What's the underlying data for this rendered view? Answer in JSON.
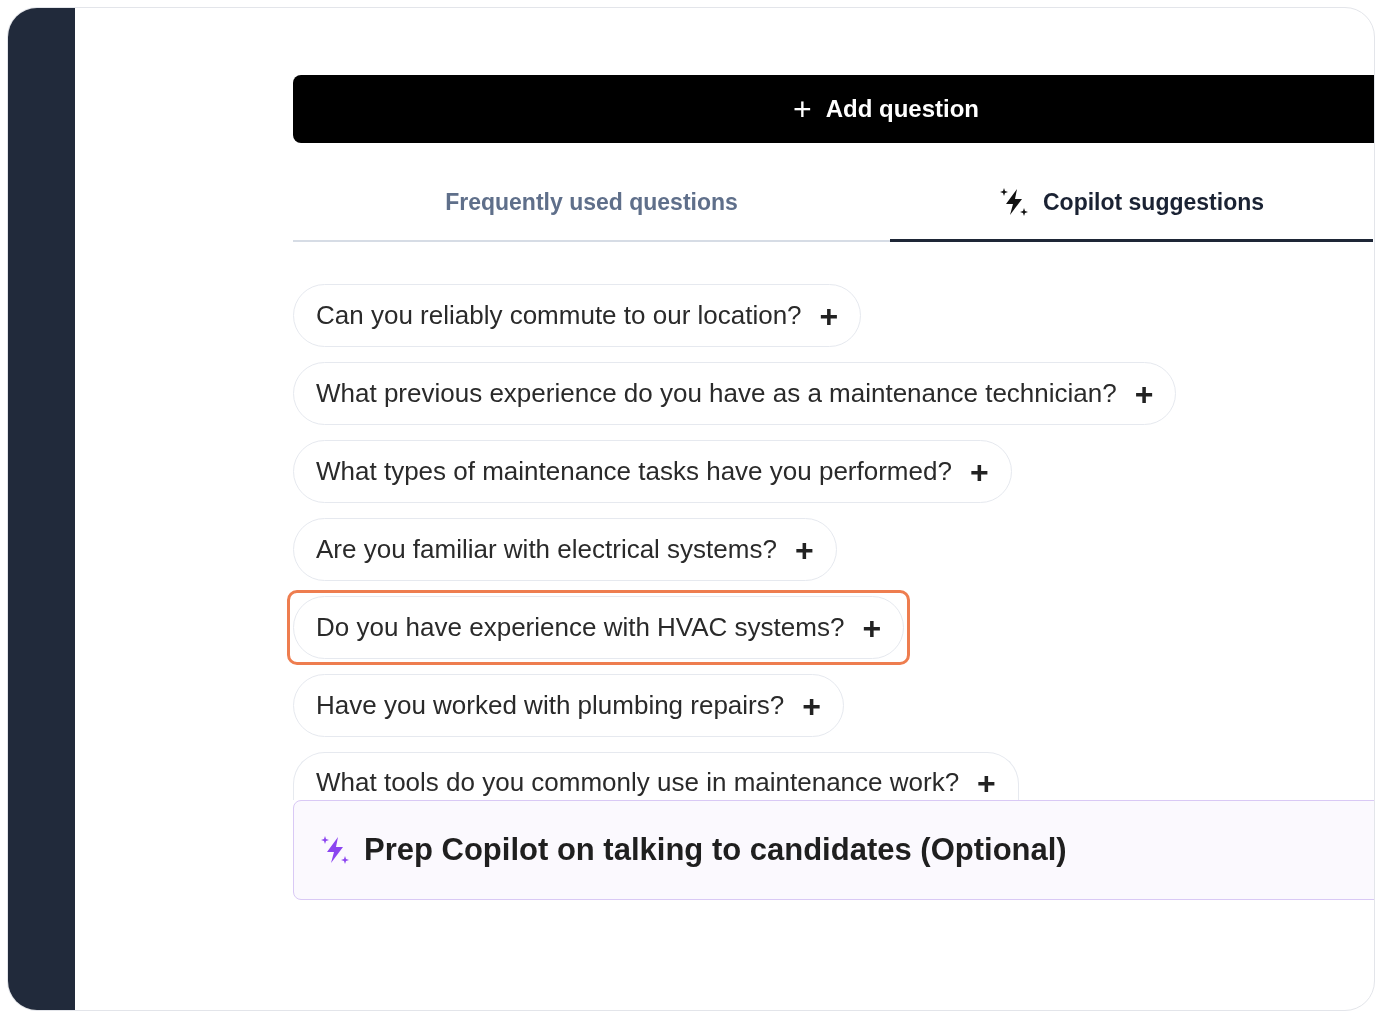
{
  "add_button": {
    "icon": "+",
    "label": "Add question"
  },
  "tabs": [
    {
      "label": "Frequently used questions",
      "selected": false,
      "kind": "plain"
    },
    {
      "label": "Copilot suggestions",
      "selected": true,
      "kind": "copilot"
    }
  ],
  "questions": [
    {
      "text": "Can you reliably commute to our location?",
      "icon": "+",
      "highlighted": false
    },
    {
      "text": "What previous experience do you have as a maintenance technician?",
      "icon": "+",
      "highlighted": false
    },
    {
      "text": "What types of maintenance tasks have you performed?",
      "icon": "+",
      "highlighted": false
    },
    {
      "text": "Are you familiar with electrical systems?",
      "icon": "+",
      "highlighted": false
    },
    {
      "text": "Do you have experience with HVAC systems?",
      "icon": "+",
      "highlighted": true
    },
    {
      "text": "Have you worked with plumbing repairs?",
      "icon": "+",
      "highlighted": false
    },
    {
      "text": "What tools do you commonly use in maintenance work?",
      "icon": "+",
      "highlighted": false
    }
  ],
  "prep_card": {
    "title": "Prep Copilot on talking to candidates (Optional)"
  }
}
